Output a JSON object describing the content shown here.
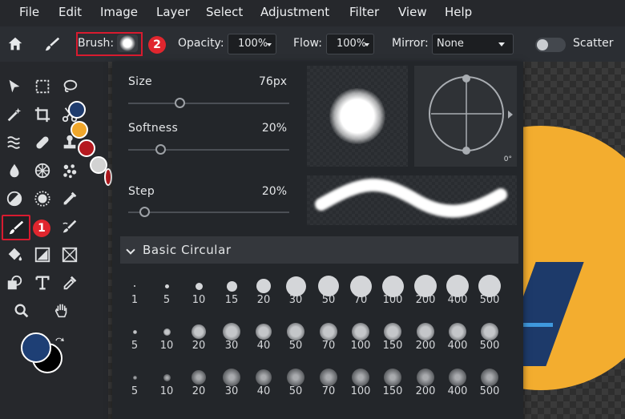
{
  "menu": [
    "File",
    "Edit",
    "Image",
    "Layer",
    "Select",
    "Adjustment",
    "Filter",
    "View",
    "Help"
  ],
  "toolbar": {
    "brush_label": "Brush:",
    "opacity_label": "Opacity:",
    "opacity_value": "100%",
    "flow_label": "Flow:",
    "flow_value": "100%",
    "mirror_label": "Mirror:",
    "mirror_value": "None",
    "scatter_label": "Scatter",
    "scatter_on": false
  },
  "badges": {
    "tool": "1",
    "brush": "2"
  },
  "tools": [
    "select-arrow",
    "marquee",
    "lasso",
    "magic-wand",
    "crop",
    "scissors",
    "liquify",
    "bandage",
    "stamp",
    "blur",
    "sponge",
    "dots",
    "contrast",
    "dodge",
    "picker",
    "brush",
    "eraser-brush",
    "fill",
    "gradient",
    "transform",
    "shape",
    "text",
    "eyedropper",
    "zoom",
    "hand"
  ],
  "palette_colors": [
    "#1f3c6e",
    "#f0a72c",
    "#b5191f",
    "#d2d2d2",
    "#b5191f"
  ],
  "foreground_color": "#1e3f75",
  "background_color": "#000000",
  "brush_settings": {
    "size_label": "Size",
    "size_value": "76px",
    "size_level": 0.32,
    "softness_label": "Softness",
    "softness_value": "20%",
    "softness_level": 0.2,
    "step_label": "Step",
    "step_value": "20%",
    "step_level": 0.1,
    "angle_value": "0°"
  },
  "preset_group": "Basic Circular",
  "preset_rows": [
    {
      "style": "hard",
      "sizes": [
        "1",
        "5",
        "10",
        "15",
        "20",
        "30",
        "50",
        "70",
        "100",
        "200",
        "400",
        "500"
      ]
    },
    {
      "style": "soft",
      "sizes": [
        "5",
        "10",
        "20",
        "30",
        "40",
        "50",
        "70",
        "100",
        "150",
        "200",
        "400",
        "500"
      ]
    },
    {
      "style": "softer",
      "sizes": [
        "5",
        "10",
        "20",
        "30",
        "40",
        "50",
        "70",
        "100",
        "150",
        "200",
        "400",
        "500"
      ]
    }
  ]
}
